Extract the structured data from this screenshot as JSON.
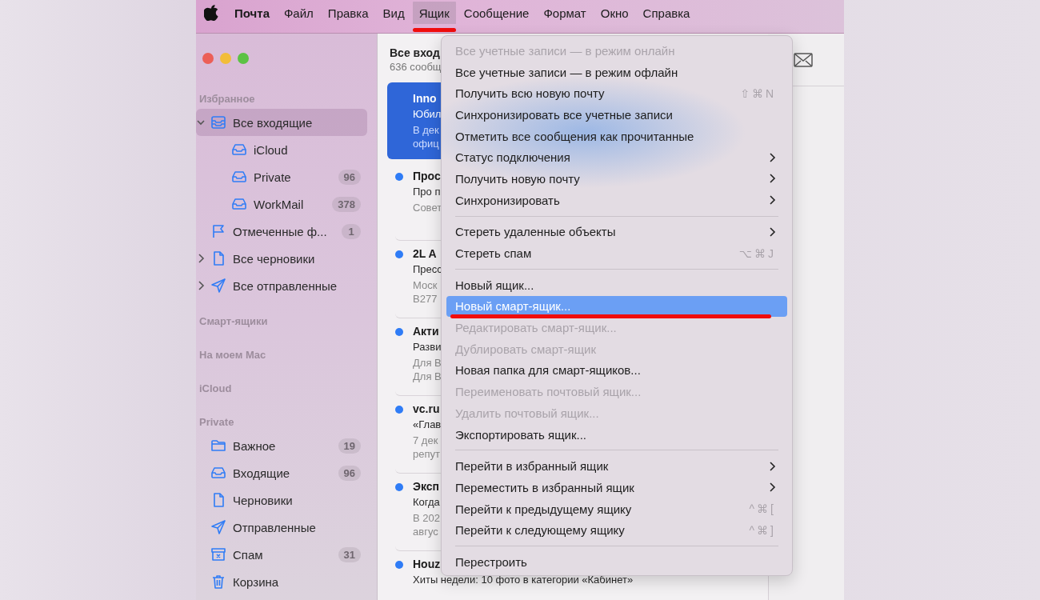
{
  "menu_bar": {
    "items": [
      {
        "label": "Почта",
        "kind": "app",
        "selected": false,
        "underlined": false
      },
      {
        "label": "Файл",
        "kind": "menu",
        "selected": false,
        "underlined": false
      },
      {
        "label": "Правка",
        "kind": "menu",
        "selected": false,
        "underlined": false
      },
      {
        "label": "Вид",
        "kind": "menu",
        "selected": false,
        "underlined": false
      },
      {
        "label": "Ящик",
        "kind": "menu",
        "selected": true,
        "underlined": true
      },
      {
        "label": "Сообщение",
        "kind": "menu",
        "selected": false,
        "underlined": false
      },
      {
        "label": "Формат",
        "kind": "menu",
        "selected": false,
        "underlined": false
      },
      {
        "label": "Окно",
        "kind": "menu",
        "selected": false,
        "underlined": false
      },
      {
        "label": "Справка",
        "kind": "menu",
        "selected": false,
        "underlined": false
      }
    ]
  },
  "sidebar": {
    "sections": [
      {
        "title": "Избранное",
        "items": [
          {
            "label": "Все входящие",
            "kind": "all-inboxes",
            "selected": true,
            "expanded": true,
            "children": [
              {
                "label": "iCloud",
                "kind": "inbox",
                "selected": false
              },
              {
                "label": "Private",
                "kind": "inbox",
                "selected": false,
                "count": "96"
              },
              {
                "label": "WorkMail",
                "kind": "inbox",
                "selected": false,
                "count": "378"
              }
            ]
          },
          {
            "label": "Отмеченные ф...",
            "kind": "flagged",
            "selected": false,
            "count": "1"
          },
          {
            "label": "Все черновики",
            "kind": "drafts",
            "selected": false,
            "expanded": false
          },
          {
            "label": "Все отправленные",
            "kind": "sent",
            "selected": false,
            "expanded": false
          }
        ]
      },
      {
        "title": "Смарт-ящики"
      },
      {
        "title": "На моем Mac"
      },
      {
        "title": "iCloud"
      },
      {
        "title": "Private",
        "items": [
          {
            "label": "Важное",
            "kind": "folder",
            "selected": false,
            "count": "19"
          },
          {
            "label": "Входящие",
            "kind": "inbox",
            "selected": false,
            "count": "96"
          },
          {
            "label": "Черновики",
            "kind": "drafts",
            "selected": false
          },
          {
            "label": "Отправленные",
            "kind": "sent",
            "selected": false
          },
          {
            "label": "Спам",
            "kind": "junk",
            "selected": false,
            "count": "31"
          },
          {
            "label": "Корзина",
            "kind": "trash",
            "selected": false
          }
        ]
      }
    ]
  },
  "message_list": {
    "title": "Все вход",
    "subtitle": "636 сообщ",
    "messages": [
      {
        "sender": "Inno",
        "subject": "Юбил",
        "preview": [
          "В дек",
          "офиц"
        ],
        "selected": true
      },
      {
        "sender": "Прос",
        "subject": "Про п",
        "preview": [
          "Совет"
        ],
        "selected": false,
        "unread": true
      },
      {
        "sender": "2L A",
        "subject": "Пресс",
        "preview": [
          "Моск",
          "B277"
        ],
        "selected": false,
        "unread": true
      },
      {
        "sender": "Акти",
        "subject": "Разви",
        "preview": [
          "Для В",
          "Для В"
        ],
        "selected": false,
        "unread": true
      },
      {
        "sender": "vc.ru",
        "subject": "«Глав",
        "preview": [
          "7 дек",
          "репут"
        ],
        "selected": false,
        "unread": true
      },
      {
        "sender": "Эксп",
        "subject": "Когда",
        "preview": [
          "В 202",
          "авгус"
        ],
        "selected": false,
        "unread": true
      },
      {
        "sender": "Houz",
        "subject": "Хиты недели: 10 фото в категории «Кабинет»",
        "selected": false,
        "unread": true
      }
    ]
  },
  "dropdown_menu": {
    "items": [
      {
        "kind": "item",
        "label": "Все учетные записи — в режим онлайн",
        "disabled": true,
        "selected": false,
        "underlined": false
      },
      {
        "kind": "item",
        "label": "Все учетные записи — в режим офлайн",
        "disabled": false,
        "selected": false,
        "underlined": false
      },
      {
        "kind": "item",
        "label": "Получить всю новую почту",
        "shortcut": "⇧⌘N",
        "disabled": false,
        "selected": false,
        "underlined": false
      },
      {
        "kind": "item",
        "label": "Синхронизировать все учетные записи",
        "disabled": false,
        "selected": false,
        "underlined": false
      },
      {
        "kind": "item",
        "label": "Отметить все сообщения как прочитанные",
        "disabled": false,
        "selected": false,
        "underlined": false
      },
      {
        "kind": "item",
        "label": "Статус подключения",
        "submenu": true,
        "disabled": false,
        "selected": false,
        "underlined": false
      },
      {
        "kind": "item",
        "label": "Получить новую почту",
        "submenu": true,
        "disabled": false,
        "selected": false,
        "underlined": false
      },
      {
        "kind": "item",
        "label": "Синхронизировать",
        "submenu": true,
        "disabled": false,
        "selected": false,
        "underlined": false
      },
      {
        "kind": "separator"
      },
      {
        "kind": "item",
        "label": "Стереть удаленные объекты",
        "submenu": true,
        "disabled": false,
        "selected": false,
        "underlined": false
      },
      {
        "kind": "item",
        "label": "Стереть спам",
        "shortcut": "⌥⌘J",
        "disabled": false,
        "selected": false,
        "underlined": false
      },
      {
        "kind": "separator"
      },
      {
        "kind": "item",
        "label": "Новый ящик...",
        "disabled": false,
        "selected": false,
        "underlined": false
      },
      {
        "kind": "item",
        "label": "Новый смарт-ящик...",
        "disabled": false,
        "selected": true,
        "underlined": true
      },
      {
        "kind": "item",
        "label": "Редактировать смарт-ящик...",
        "disabled": true,
        "selected": false,
        "underlined": false
      },
      {
        "kind": "item",
        "label": "Дублировать смарт-ящик",
        "disabled": true,
        "selected": false,
        "underlined": false
      },
      {
        "kind": "item",
        "label": "Новая папка для смарт-ящиков...",
        "disabled": false,
        "selected": false,
        "underlined": false
      },
      {
        "kind": "item",
        "label": "Переименовать почтовый ящик...",
        "disabled": true,
        "selected": false,
        "underlined": false
      },
      {
        "kind": "item",
        "label": "Удалить почтовый ящик...",
        "disabled": true,
        "selected": false,
        "underlined": false
      },
      {
        "kind": "item",
        "label": "Экспортировать ящик...",
        "disabled": false,
        "selected": false,
        "underlined": false
      },
      {
        "kind": "separator"
      },
      {
        "kind": "item",
        "label": "Перейти в избранный ящик",
        "submenu": true,
        "disabled": false,
        "selected": false,
        "underlined": false
      },
      {
        "kind": "item",
        "label": "Переместить в избранный ящик",
        "submenu": true,
        "disabled": false,
        "selected": false,
        "underlined": false
      },
      {
        "kind": "item",
        "label": "Перейти к предыдущему ящику",
        "shortcut": "^⌘[",
        "disabled": false,
        "selected": false,
        "underlined": false
      },
      {
        "kind": "item",
        "label": "Перейти к следующему ящику",
        "shortcut": "^⌘]",
        "disabled": false,
        "selected": false,
        "underlined": false
      },
      {
        "kind": "separator"
      },
      {
        "kind": "item",
        "label": "Перестроить",
        "disabled": false,
        "selected": false,
        "underlined": false
      }
    ]
  }
}
